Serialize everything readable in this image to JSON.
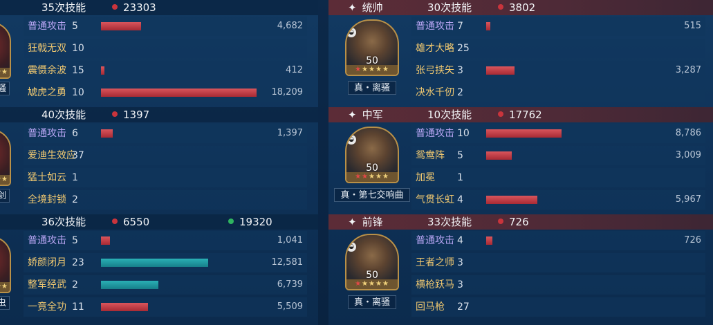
{
  "left": {
    "sections": [
      {
        "header": {
          "casts": "35次技能",
          "damage": "23303",
          "heal": ""
        },
        "portrait_caption": "骚",
        "stars": "★★",
        "skills": [
          {
            "name": "普通攻击",
            "level": "5",
            "value": "4,682",
            "fraction": 0.257,
            "bar": "red",
            "basic": true
          },
          {
            "name": "狂戟无双",
            "level": "10",
            "value": "",
            "fraction": 0,
            "bar": "red"
          },
          {
            "name": "震慑余波",
            "level": "15",
            "value": "412",
            "fraction": 0.023,
            "bar": "red"
          },
          {
            "name": "虓虎之勇",
            "level": "10",
            "value": "18,209",
            "fraction": 1.0,
            "bar": "red"
          }
        ]
      },
      {
        "header": {
          "casts": "40次技能",
          "damage": "1397",
          "heal": ""
        },
        "portrait_caption": "剑",
        "stars": "★★",
        "skills": [
          {
            "name": "普通攻击",
            "level": "6",
            "value": "1,397",
            "fraction": 0.077,
            "bar": "red",
            "basic": true
          },
          {
            "name": "爱迪生效应",
            "level": "37",
            "value": "",
            "fraction": 0,
            "bar": "red"
          },
          {
            "name": "猛士如云",
            "level": "1",
            "value": "",
            "fraction": 0,
            "bar": "red"
          },
          {
            "name": "全境封锁",
            "level": "2",
            "value": "",
            "fraction": 0,
            "bar": "red"
          }
        ]
      },
      {
        "header": {
          "casts": "36次技能",
          "damage": "6550",
          "heal": "19320"
        },
        "portrait_caption": "虫",
        "stars": "★★",
        "skills": [
          {
            "name": "普通攻击",
            "level": "5",
            "value": "1,041",
            "fraction": 0.057,
            "bar": "red",
            "basic": true
          },
          {
            "name": "娇颜闭月",
            "level": "23",
            "value": "12,581",
            "fraction": 0.691,
            "bar": "teal"
          },
          {
            "name": "整军经武",
            "level": "2",
            "value": "6,739",
            "fraction": 0.37,
            "bar": "teal"
          },
          {
            "name": "一竟全功",
            "level": "11",
            "value": "5,509",
            "fraction": 0.303,
            "bar": "red"
          }
        ]
      }
    ]
  },
  "right": {
    "sections": [
      {
        "header": {
          "role": "统帅",
          "casts": "30次技能",
          "damage": "3802"
        },
        "level": "50",
        "caption": "真・离骚",
        "stars_red": "★",
        "stars": "★★★★",
        "skills": [
          {
            "name": "普通攻击",
            "level": "7",
            "value": "515",
            "fraction": 0.028,
            "bar": "red",
            "basic": true
          },
          {
            "name": "雄才大略",
            "level": "25",
            "value": "",
            "fraction": 0,
            "bar": "red"
          },
          {
            "name": "张弓挟矢",
            "level": "3",
            "value": "3,287",
            "fraction": 0.181,
            "bar": "red"
          },
          {
            "name": "决水千仞",
            "level": "2",
            "value": "",
            "fraction": 0,
            "bar": "red"
          }
        ]
      },
      {
        "header": {
          "role": "中军",
          "casts": "10次技能",
          "damage": "17762"
        },
        "level": "50",
        "caption": "真・第七交响曲",
        "stars_red": "★★",
        "stars": "★★★",
        "skills": [
          {
            "name": "普通攻击",
            "level": "10",
            "value": "8,786",
            "fraction": 0.483,
            "bar": "red",
            "basic": true
          },
          {
            "name": "鸳鸯阵",
            "level": "5",
            "value": "3,009",
            "fraction": 0.165,
            "bar": "red"
          },
          {
            "name": "加冕",
            "level": "1",
            "value": "",
            "fraction": 0,
            "bar": "red"
          },
          {
            "name": "气贯长虹",
            "level": "4",
            "value": "5,967",
            "fraction": 0.328,
            "bar": "red"
          }
        ]
      },
      {
        "header": {
          "role": "前锋",
          "casts": "33次技能",
          "damage": "726"
        },
        "level": "50",
        "caption": "真・离骚",
        "stars_red": "★",
        "stars": "★★★★",
        "skills": [
          {
            "name": "普通攻击",
            "level": "4",
            "value": "726",
            "fraction": 0.04,
            "bar": "red",
            "basic": true
          },
          {
            "name": "王者之师",
            "level": "3",
            "value": "",
            "fraction": 0,
            "bar": "red"
          },
          {
            "name": "横枪跃马",
            "level": "3",
            "value": "",
            "fraction": 0,
            "bar": "red"
          },
          {
            "name": "回马枪",
            "level": "27",
            "value": "",
            "fraction": 0,
            "bar": "red"
          }
        ]
      }
    ]
  }
}
